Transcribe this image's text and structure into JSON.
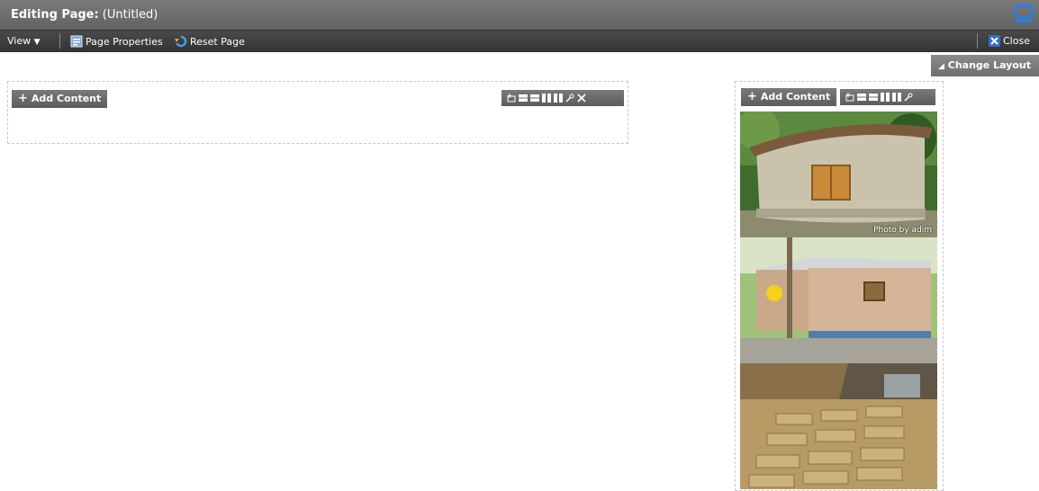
{
  "header": {
    "title_prefix": "Editing Page:",
    "title_value": " (Untitled)",
    "brand_icon": "oracle-icon"
  },
  "toolbar": {
    "view_label": "View",
    "page_properties_label": "Page Properties",
    "reset_page_label": "Reset Page",
    "close_label": "Close"
  },
  "layout": {
    "change_layout_label": "Change Layout"
  },
  "left_region": {
    "add_content_label": "Add Content"
  },
  "right_region": {
    "add_content_label": "Add Content",
    "photo_credit": "Photo by adim"
  },
  "colors": {
    "header_bg": "#6a6a6a",
    "toolbar_bg": "#3c3c3c",
    "button_bg": "#6a6a6a",
    "brand_blue": "#1f6fd0"
  }
}
